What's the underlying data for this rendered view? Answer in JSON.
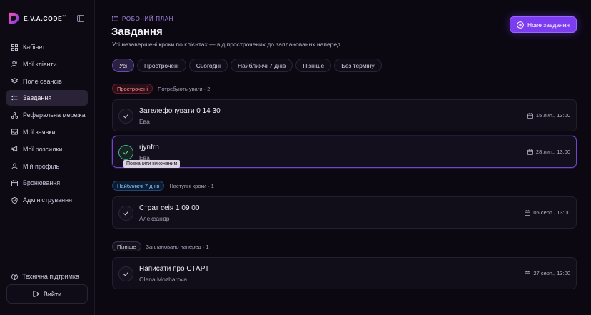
{
  "brand": {
    "name": "E.V.A.CODE",
    "trademark": "™"
  },
  "sidebar": {
    "items": [
      {
        "label": "Кабінет",
        "icon": "grid-icon",
        "active": false
      },
      {
        "label": "Мої клієнти",
        "icon": "users-icon",
        "active": false
      },
      {
        "label": "Поле сеансів",
        "icon": "layers-icon",
        "active": false
      },
      {
        "label": "Завдання",
        "icon": "task-list-icon",
        "active": true
      },
      {
        "label": "Реферальна мережа",
        "icon": "network-icon",
        "active": false
      },
      {
        "label": "Мої заявки",
        "icon": "inbox-icon",
        "active": false
      },
      {
        "label": "Мої розсилки",
        "icon": "megaphone-icon",
        "active": false
      },
      {
        "label": "Мій профіль",
        "icon": "user-icon",
        "active": false
      },
      {
        "label": "Бронювання",
        "icon": "calendar-icon",
        "active": false
      },
      {
        "label": "Адміністрування",
        "icon": "shield-icon",
        "active": false
      }
    ],
    "support_label": "Технічна підтримка",
    "logout_label": "Вийти"
  },
  "header": {
    "kicker": "РОБОЧИЙ ПЛАН",
    "title": "Завдання",
    "subtitle": "Усі незавершені кроки по клієнтах — від прострочених до запланованих наперед.",
    "new_task_label": "Нове завдання"
  },
  "filters": [
    {
      "label": "Усі",
      "active": true
    },
    {
      "label": "Прострочені",
      "active": false
    },
    {
      "label": "Сьогодні",
      "active": false
    },
    {
      "label": "Найближчі 7 днів",
      "active": false
    },
    {
      "label": "Пізніше",
      "active": false
    },
    {
      "label": "Без терміну",
      "active": false
    }
  ],
  "groups": [
    {
      "badge": "Прострочені",
      "caption": "Потребують уваги · 2",
      "tone": "red",
      "tasks": [
        {
          "title": "Зателефонувати 0 14 30",
          "client": "Ева",
          "date": "15 лип., 13:00"
        },
        {
          "title": "rjynfrn",
          "client": "Ева",
          "date": "28 лип., 13:00"
        }
      ]
    },
    {
      "badge": "Найближчі 7 днів",
      "caption": "Наступні кроки · 1",
      "tone": "blue",
      "tasks": [
        {
          "title": "Страт сеія 1 09 00",
          "client": "Александр",
          "date": "05 серп., 13:00"
        }
      ]
    },
    {
      "badge": "Пізніше",
      "caption": "Заплановано наперед · 1",
      "tone": "gray",
      "tasks": [
        {
          "title": "Написати про СТАРТ",
          "client": "Olena Mozharova",
          "date": "27 серп., 13:00"
        }
      ]
    }
  ],
  "tooltip": "Позначити виконаним",
  "colors": {
    "accent": "#7c3cf0",
    "overdue": "#ff8a98",
    "upcoming": "#7cc3ff",
    "done_check": "#3fb39a"
  }
}
